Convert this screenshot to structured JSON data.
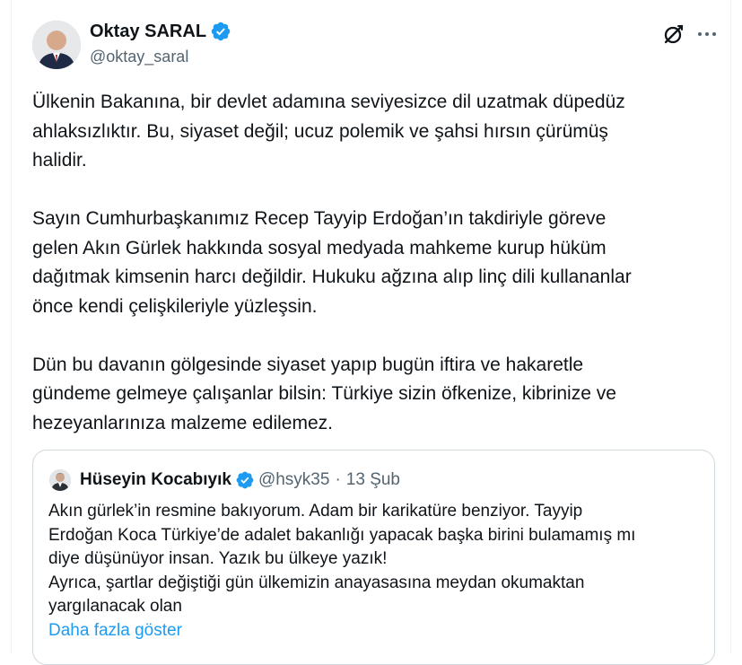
{
  "author": {
    "name": "Oktay SARAL",
    "handle": "@oktay_saral",
    "verified_color": "#1d9bf0"
  },
  "actions": {
    "grok_icon": "grok-icon",
    "more_icon": "more-horizontal-icon"
  },
  "tweet": {
    "paragraphs": [
      "Ülkenin Bakanına, bir devlet adamına seviyesizce dil uzatmak düpedüz\nahlaksızlıktır. Bu, siyaset değil; ucuz polemik ve şahsi hırsın çürümüş\nhalidir.",
      "Sayın Cumhurbaşkanımız Recep Tayyip Erdoğan’ın takdiriyle göreve\ngelen Akın Gürlek hakkında sosyal medyada mahkeme kurup hüküm\ndağıtmak kimsenin harcı değildir. Hukuku ağzına alıp linç dili kullananlar\nönce kendi çelişkileriyle yüzleşsin.",
      "Dün bu davanın gölgesinde siyaset yapıp bugün iftira ve hakaretle\ngündeme gelmeye çalışanlar bilsin: Türkiye sizin öfkenize, kibrinize ve\nhezeyanlarınıza malzeme edilemez."
    ]
  },
  "quote": {
    "name": "Hüseyin Kocabıyık",
    "handle": "@hsyk35",
    "separator": "·",
    "date": "13 Şub",
    "text": "Akın gürlek’in resmine bakıyorum. Adam bir karikatüre benziyor. Tayyip\nErdoğan Koca Türkiye’de adalet bakanlığı yapacak başka birini bulamamış mı\ndiye düşünüyor insan. Yazık bu ülkeye yazık!\nAyrıca, şartlar değiştiği gün ülkemizin anayasasına meydan okumaktan\nyargılanacak olan",
    "show_more": "Daha fazla göster",
    "link_color": "#1d9bf0"
  }
}
